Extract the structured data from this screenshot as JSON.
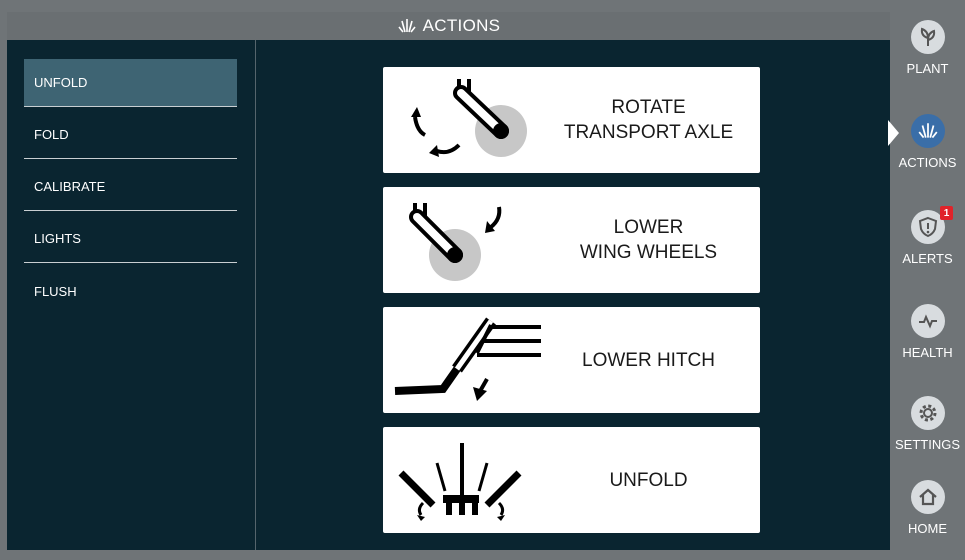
{
  "header": {
    "title": "ACTIONS",
    "icon": "actions-icon"
  },
  "menu": {
    "items": [
      {
        "label": "UNFOLD",
        "active": true
      },
      {
        "label": "FOLD",
        "active": false
      },
      {
        "label": "CALIBRATE",
        "active": false
      },
      {
        "label": "LIGHTS",
        "active": false
      },
      {
        "label": "FLUSH",
        "active": false
      }
    ]
  },
  "actions": [
    {
      "label": "ROTATE\nTRANSPORT AXLE",
      "icon": "rotate-axle-icon"
    },
    {
      "label": "LOWER\nWING WHEELS",
      "icon": "wing-wheels-icon"
    },
    {
      "label": "LOWER HITCH",
      "icon": "hitch-icon"
    },
    {
      "label": "UNFOLD",
      "icon": "unfold-icon"
    }
  ],
  "nav": [
    {
      "label": "PLANT",
      "icon": "plant-icon"
    },
    {
      "label": "ACTIONS",
      "icon": "actions-icon",
      "active": true
    },
    {
      "label": "ALERTS",
      "icon": "alert-shield-icon",
      "badge": "1"
    },
    {
      "label": "HEALTH",
      "icon": "heartbeat-icon"
    },
    {
      "label": "SETTINGS",
      "icon": "gear-icon"
    },
    {
      "label": "HOME",
      "icon": "home-icon"
    }
  ],
  "colors": {
    "background": "#0a2530",
    "active_item": "#3e6473",
    "sidebar": "#6f7477",
    "badge": "#e0232a",
    "accent": "#3a6ea8"
  }
}
